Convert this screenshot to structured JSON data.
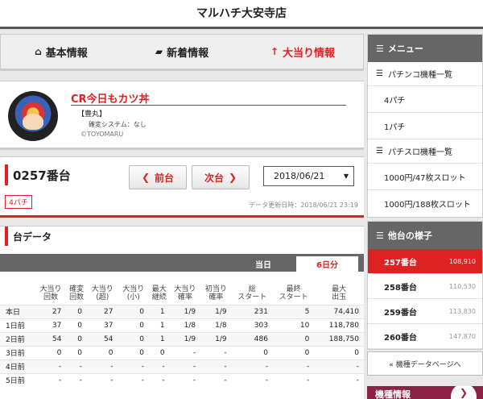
{
  "header": {
    "title": "マルハチ大安寺店"
  },
  "nav": {
    "tabs": [
      {
        "label": "基本情報",
        "icon": "home-icon",
        "active": false
      },
      {
        "label": "新着情報",
        "icon": "chat-icon",
        "active": false
      },
      {
        "label": "大当り情報",
        "icon": "arrow-up-icon",
        "active": true
      }
    ]
  },
  "machine": {
    "name": "CR今日もカツ丼",
    "maker": "【豊丸】",
    "spec": "確変システム：なし",
    "copyright": "©TOYOMARU"
  },
  "unit": {
    "number": "0257番台",
    "prev_label": "前台",
    "next_label": "次台",
    "date": "2018/06/21",
    "tag": "4パチ",
    "updated": "データ更新日時：2018/06/21 23:19"
  },
  "data_section": {
    "title": "台データ",
    "tab_today": "当日",
    "tab_6days": "6日分",
    "columns": [
      "",
      "大当り\n回数",
      "確変\n回数",
      "大当り\n(超)",
      "大当り\n(小)",
      "最大\n継続",
      "大当り\n確率",
      "初当り\n確率",
      "総\nスタート",
      "最終\nスタート",
      "最大\n出玉"
    ],
    "rows": [
      [
        "本日",
        "27",
        "0",
        "27",
        "0",
        "1",
        "1/9",
        "1/9",
        "231",
        "5",
        "74,410"
      ],
      [
        "1日前",
        "37",
        "0",
        "37",
        "0",
        "1",
        "1/8",
        "1/8",
        "303",
        "10",
        "118,780"
      ],
      [
        "2日前",
        "54",
        "0",
        "54",
        "0",
        "1",
        "1/9",
        "1/9",
        "486",
        "0",
        "188,750"
      ],
      [
        "3日前",
        "0",
        "0",
        "0",
        "0",
        "0",
        "-",
        "-",
        "0",
        "0",
        "0"
      ],
      [
        "4日前",
        "-",
        "-",
        "-",
        "-",
        "-",
        "-",
        "-",
        "-",
        "-",
        "-"
      ],
      [
        "5日前",
        "-",
        "-",
        "-",
        "-",
        "-",
        "-",
        "-",
        "-",
        "-",
        "-"
      ]
    ]
  },
  "sidebar": {
    "menu_title": "メニュー",
    "pachinko_list": "パチンコ機種一覧",
    "pachinko_items": [
      "4パチ",
      "1パチ"
    ],
    "slot_list": "パチスロ機種一覧",
    "slot_items": [
      "1000円/47枚スロット",
      "1000円/188枚スロット"
    ],
    "others_title": "他台の様子",
    "others": [
      {
        "unit": "257番台",
        "value": "108,910",
        "selected": true
      },
      {
        "unit": "258番台",
        "value": "110,530",
        "selected": false
      },
      {
        "unit": "259番台",
        "value": "113,830",
        "selected": false
      },
      {
        "unit": "260番台",
        "value": "147,870",
        "selected": false
      }
    ],
    "back_button": "« 機種データページへ",
    "banner_label": "機種情報"
  },
  "colors": {
    "accent": "#dd2222",
    "header_gray": "#666666",
    "banner": "#8b2246"
  }
}
